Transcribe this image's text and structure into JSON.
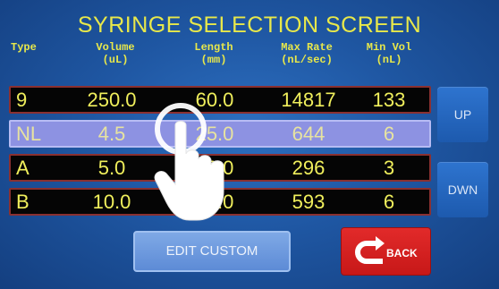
{
  "screen": {
    "title": "SYRINGE SELECTION SCREEN"
  },
  "headers": [
    {
      "line1": "Type",
      "line2": ""
    },
    {
      "line1": "Volume",
      "line2": "(uL)"
    },
    {
      "line1": "Length",
      "line2": "(mm)"
    },
    {
      "line1": "Max Rate",
      "line2": "(nL/sec)"
    },
    {
      "line1": "Min Vol",
      "line2": "(nL)"
    }
  ],
  "rows": [
    {
      "type": "9",
      "volume": "250.0",
      "length": "60.0",
      "max_rate": "14817",
      "min_vol": "133",
      "selected": false
    },
    {
      "type": "NL",
      "volume": "4.5",
      "length": "25.0",
      "max_rate": "644",
      "min_vol": "6",
      "selected": true
    },
    {
      "type": "A",
      "volume": "5.0",
      "length": "30.0",
      "max_rate": "296",
      "min_vol": "3",
      "selected": false
    },
    {
      "type": "B",
      "volume": "10.0",
      "length": "60.0",
      "max_rate": "593",
      "min_vol": "6",
      "selected": false
    }
  ],
  "buttons": {
    "up": "UP",
    "down": "DWN",
    "edit_custom": "EDIT CUSTOM",
    "back": "BACK"
  },
  "colors": {
    "background": "#1f57a3",
    "text_yellow": "#e8e84a",
    "row_border": "#8a3030",
    "selected_row": "#8d92e2",
    "back_button": "#d82020"
  },
  "overlay": {
    "icon": "tap-hand-icon"
  }
}
